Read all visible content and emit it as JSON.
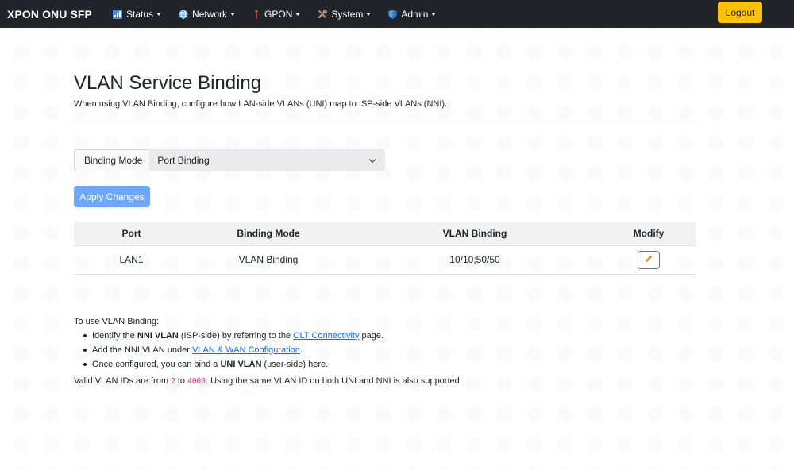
{
  "navbar": {
    "brand": "XPON ONU SFP",
    "items": [
      {
        "label": "Status",
        "icon": "bar-chart-icon"
      },
      {
        "label": "Network",
        "icon": "globe-icon"
      },
      {
        "label": "GPON",
        "icon": "antenna-icon"
      },
      {
        "label": "System",
        "icon": "tools-icon"
      },
      {
        "label": "Admin",
        "icon": "shield-icon"
      }
    ],
    "logout_label": "Logout"
  },
  "colors": {
    "navbar_bg": "#212529",
    "logout_bg": "#ffc107",
    "apply_bg": "#6ea8fe",
    "link": "#0d6efd",
    "code": "#d63384",
    "edit_icon": "#fd7e14"
  },
  "page": {
    "title": "VLAN Service Binding",
    "subtitle": "When using VLAN Binding, configure how LAN-side VLANs (UNI) map to ISP-side VLANs (NNI)."
  },
  "form": {
    "binding_mode_label": "Binding Mode",
    "binding_mode_value": "Port Binding",
    "apply_label": "Apply Changes"
  },
  "table": {
    "headers": [
      "Port",
      "Binding Mode",
      "VLAN Binding",
      "Modify"
    ],
    "rows": [
      {
        "port": "LAN1",
        "mode": "VLAN Binding",
        "vlan": "10/10;50/50",
        "modify_icon": "pencil-icon"
      }
    ]
  },
  "help": {
    "intro": "To use VLAN Binding:",
    "item1": {
      "pre": "Identify the ",
      "bold": "NNI VLAN",
      "mid": " (ISP-side) by referring to the ",
      "link": "OLT Connectivity",
      "post": " page."
    },
    "item2": {
      "pre": "Add the NNI VLAN under ",
      "link": "VLAN & WAN Configuration",
      "post": "."
    },
    "item3": {
      "pre": "Once configured, you can bind a ",
      "bold": "UNI VLAN",
      "post": " (user-side) here."
    },
    "valid": {
      "pre": "Valid VLAN IDs are from ",
      "min": "2",
      "mid": " to ",
      "max": "4000",
      "post": ". Using the same VLAN ID on both UNI and NNI is also supported."
    }
  }
}
